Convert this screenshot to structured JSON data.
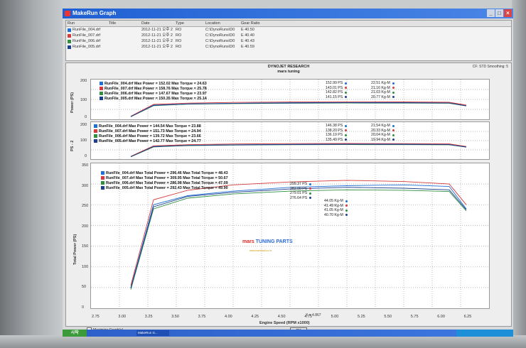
{
  "window": {
    "title": "MakeRun Graph"
  },
  "file_list": {
    "columns": [
      "Run",
      "Title",
      "Date",
      "Type",
      "Location",
      "Gear Ratio"
    ],
    "rows": [
      {
        "run": "RunFile_004.drf",
        "date": "2012-11-21 오후 2",
        "type": "RO",
        "location": "C:\\DynoRuns\\D0",
        "gear": "E 40.50",
        "color": "#1e6fd6"
      },
      {
        "run": "RunFile_007.drf",
        "date": "2012-11-21 오후 2",
        "type": "RO",
        "location": "C:\\DynoRuns\\D0",
        "gear": "E 40.40",
        "color": "#d63a3a"
      },
      {
        "run": "RunFile_006.drf",
        "date": "2012-11-21 오후 2",
        "type": "RO",
        "location": "C:\\DynoRuns\\D0",
        "gear": "E 40.43",
        "color": "#2f8f3f"
      },
      {
        "run": "RunFile_005.drf",
        "date": "2012-11-21 오후 2",
        "type": "RO",
        "location": "C:\\DynoRuns\\D0",
        "gear": "E 40.59",
        "color": "#1c3f8f"
      }
    ]
  },
  "header": {
    "line1": "DYNOJET RESEARCH",
    "line2": "mars tuning",
    "correction": "CF: STD  Smoothing: 5"
  },
  "panels": {
    "power": {
      "ylabel": "Power (PS)",
      "yticks": [
        "200",
        "100",
        "0"
      ],
      "legend": [
        "RunFile_004.drf Max Power = 152.02 Max Torque = 24.63",
        "RunFile_007.drf Max Power = 158.76 Max Torque = 25.78",
        "RunFile_006.drf Max Power = 147.67 Max Torque = 23.97",
        "RunFile_005.drf Max Power = 150.35 Max Torque = 25.14"
      ],
      "power_vals": [
        "152.99 PS",
        "143.01 PS",
        "142.82 PS",
        "141.15 PS"
      ],
      "torque_vals": [
        "22.51 Kg-M",
        "21.16 Kg-M",
        "21.03 Kg-M",
        "20.77 Kg-M"
      ]
    },
    "ps2": {
      "ylabel": "PS - 2",
      "yticks": [
        "200",
        "100",
        "0"
      ],
      "legend": [
        "RunFile_004.drf Max Power = 144.54 Max Torque = 23.88",
        "RunFile_007.drf Max Power = 151.73 Max Torque = 24.94",
        "RunFile_006.drf Max Power = 139.72 Max Torque = 23.66",
        "RunFile_005.drf Max Power = 142.77 Max Torque = 24.77"
      ],
      "power_vals": [
        "146.38 PS",
        "138.20 PS",
        "136.19 PS",
        "135.49 PS"
      ],
      "torque_vals": [
        "21.54 Kg-M",
        "20.33 Kg-M",
        "20.04 Kg-M",
        "19.94 Kg-M"
      ]
    },
    "total": {
      "ylabel": "Total Power (PS)",
      "xlabel": "Engine Speed (RPM x1000)",
      "yticks": [
        "350",
        "300",
        "250",
        "200",
        "150",
        "100",
        "50",
        "0"
      ],
      "xticks": [
        "2.75",
        "3.00",
        "3.25",
        "3.50",
        "3.75",
        "4.00",
        "4.25",
        "4.50",
        "4.75",
        "5.00",
        "5.25",
        "5.50",
        "5.75",
        "6.00",
        "6.25"
      ],
      "legend": [
        "RunFile_004.drf Max Total Power = 296.46 Max Total Torque = 48.43",
        "RunFile_007.drf Max Total Power = 309.95 Max Total Torque = 50.67",
        "RunFile_006.drf Max Total Power = 286.98 Max Total Torque = 47.09",
        "RunFile_005.drf Max Total Power = 292.43 Max Total Torque = 49.90"
      ],
      "power_vals": [
        "299.37 PS",
        "282.00 PS",
        "279.01 PS",
        "276.64 PS"
      ],
      "torque_vals": [
        "44.05 Kg-M",
        "41.49 Kg-M",
        "41.05 Kg-M",
        "40.70 Kg-M"
      ],
      "marker": "X = 4.867"
    }
  },
  "logo": {
    "text_red": "mars",
    "text_blue": "TUNING PARTS",
    "sub": "www.marsmall.co.kr"
  },
  "footer": {
    "maximize_label": "Maximize Graph(s)",
    "ok_label": "OK"
  },
  "taskbar": {
    "start": "시작",
    "task": "MakeRun G..."
  },
  "colors": {
    "run004": "#1e6fd6",
    "run007": "#d63a3a",
    "run006": "#2f8f3f",
    "run005": "#1c3f8f"
  },
  "chart_data": {
    "type": "line",
    "xlabel": "Engine Speed (RPM x1000)",
    "ylabel": "Total Power (PS)",
    "xlim": [
      2.75,
      6.25
    ],
    "ylim": [
      0,
      350
    ],
    "grid": true,
    "series": [
      {
        "name": "RunFile_004.drf",
        "x": [
          3.1,
          3.3,
          3.6,
          4.0,
          4.5,
          5.0,
          5.5,
          5.9,
          6.05
        ],
        "y": [
          50,
          250,
          272,
          283,
          292,
          296,
          298,
          294,
          240
        ]
      },
      {
        "name": "RunFile_007.drf",
        "x": [
          3.1,
          3.3,
          3.6,
          4.0,
          4.5,
          5.0,
          5.5,
          5.9,
          6.05
        ],
        "y": [
          55,
          262,
          285,
          298,
          305,
          309,
          306,
          300,
          250
        ]
      },
      {
        "name": "RunFile_006.drf",
        "x": [
          3.1,
          3.3,
          3.6,
          4.0,
          4.5,
          5.0,
          5.5,
          5.9,
          6.05
        ],
        "y": [
          45,
          240,
          266,
          276,
          283,
          286,
          285,
          282,
          235
        ]
      },
      {
        "name": "RunFile_005.drf",
        "x": [
          3.1,
          3.3,
          3.6,
          4.0,
          4.5,
          5.0,
          5.5,
          5.9,
          6.05
        ],
        "y": [
          48,
          245,
          270,
          280,
          288,
          292,
          290,
          286,
          238
        ]
      }
    ]
  }
}
